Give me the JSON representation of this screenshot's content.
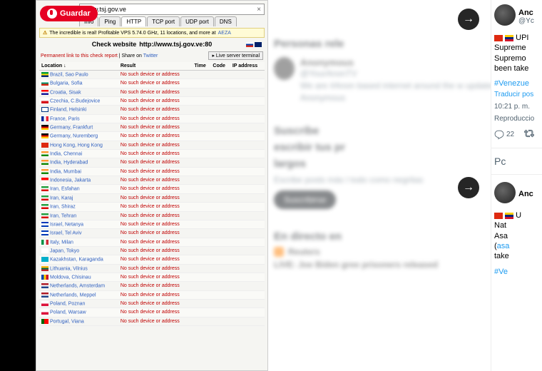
{
  "save_button": {
    "label": "Guardar"
  },
  "url_input": {
    "value": "Www.tsj.gov.ve"
  },
  "tabs": [
    "Info",
    "Ping",
    "HTTP",
    "TCP port",
    "UDP port",
    "DNS"
  ],
  "notice": {
    "icon": "⚠",
    "text": "The incredible is real! Profitable VPS 5.74.0 GHz, 11 locations, and more at",
    "link": "AEZA"
  },
  "check_header": {
    "label": "Check website",
    "url": "http://www.tsj.gov.ve:80"
  },
  "perma": {
    "text": "Permanent link to this check report",
    "share": "Share on",
    "twitter": "Twitter"
  },
  "live_terminal": "Live server terminal",
  "table": {
    "headers": {
      "location": "Location ↓",
      "result": "Result",
      "time": "Time",
      "code": "Code",
      "ip": "IP address"
    },
    "no_device": "No such device or address",
    "rows": [
      {
        "flag": "fl-br",
        "loc": "Brazil, Sao Paulo"
      },
      {
        "flag": "fl-bg",
        "loc": "Bulgaria, Sofia"
      },
      {
        "flag": "fl-hr",
        "loc": "Croatia, Sisak"
      },
      {
        "flag": "fl-cz",
        "loc": "Czechia, C.Budejovice"
      },
      {
        "flag": "fl-fi",
        "loc": "Finland, Helsinki"
      },
      {
        "flag": "fl-fr",
        "loc": "France, Paris"
      },
      {
        "flag": "fl-de",
        "loc": "Germany, Frankfurt"
      },
      {
        "flag": "fl-de",
        "loc": "Germany, Nuremberg"
      },
      {
        "flag": "fl-hk",
        "loc": "Hong Kong, Hong Kong"
      },
      {
        "flag": "fl-in",
        "loc": "India, Chennai"
      },
      {
        "flag": "fl-in",
        "loc": "India, Hyderabad"
      },
      {
        "flag": "fl-in",
        "loc": "India, Mumbai"
      },
      {
        "flag": "fl-id",
        "loc": "Indonesia, Jakarta"
      },
      {
        "flag": "fl-ir",
        "loc": "Iran, Esfahan"
      },
      {
        "flag": "fl-ir",
        "loc": "Iran, Karaj"
      },
      {
        "flag": "fl-ir",
        "loc": "Iran, Shiraz"
      },
      {
        "flag": "fl-ir",
        "loc": "Iran, Tehran"
      },
      {
        "flag": "fl-il",
        "loc": "Israel, Netanya"
      },
      {
        "flag": "fl-il",
        "loc": "Israel, Tel Aviv"
      },
      {
        "flag": "fl-it",
        "loc": "Italy, Milan"
      },
      {
        "flag": "fl-jp",
        "loc": "Japan, Tokyo"
      },
      {
        "flag": "fl-kz",
        "loc": "Kazakhstan, Karaganda"
      },
      {
        "flag": "fl-lt",
        "loc": "Lithuania, Vilnius"
      },
      {
        "flag": "fl-md",
        "loc": "Moldova, Chisinau"
      },
      {
        "flag": "fl-nl",
        "loc": "Netherlands, Amsterdam"
      },
      {
        "flag": "fl-nl",
        "loc": "Netherlands, Meppel"
      },
      {
        "flag": "fl-pl",
        "loc": "Poland, Poznan"
      },
      {
        "flag": "fl-pl",
        "loc": "Poland, Warsaw"
      },
      {
        "flag": "fl-pt",
        "loc": "Portugal, Viana"
      }
    ]
  },
  "blur": {
    "relevant": "Personas rele",
    "anon_name": "Anonymous",
    "anon_handle": "@YourAnonTV",
    "anon_text": "We are #Anon based internet around the w updates on p Anonymous",
    "sub_h1": "Suscríbe",
    "sub_h2": "escribir tus pr",
    "sub_h3": "largos",
    "sub_text": "Escribe posts más l todo como negritas",
    "sub_btn": "Suscribirse",
    "live_h": "En directo en",
    "reuters": "Reuters",
    "live_text": "LIVE: Joe Biden gree prisoners released"
  },
  "nav": {
    "next": "→"
  },
  "tweet1": {
    "name": "Anc",
    "handle": "@Yc",
    "body_prefix": "UPI",
    "line1": "Supreme",
    "line2": "Supremo",
    "line3": "been take",
    "hashtag": "#Venezue",
    "translate": "Traducir pos",
    "time": "10:21 p. m.",
    "repro": "Reproduccio",
    "reply_count": "22"
  },
  "post_prompt": "Pc",
  "tweet2": {
    "name": "Anc",
    "body_prefix": "U",
    "line1": "Nat",
    "line2": "Asa",
    "link": "asa",
    "line3": "take",
    "hashtag": "#Ve"
  }
}
